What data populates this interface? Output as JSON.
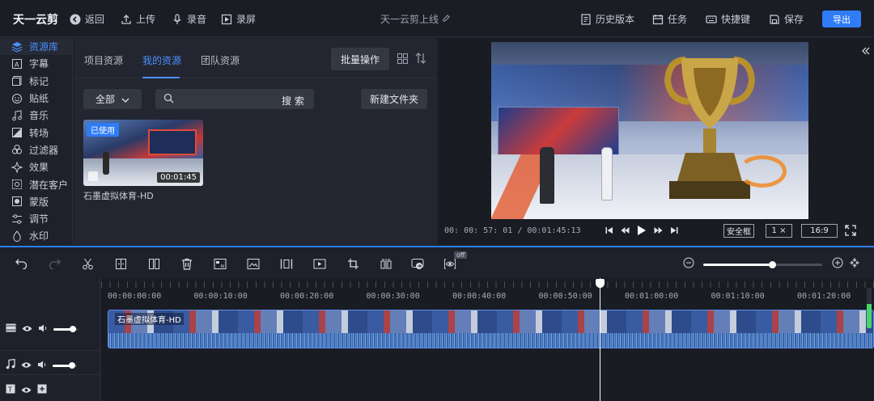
{
  "topbar": {
    "app_title": "天一云剪",
    "back": "返回",
    "upload": "上传",
    "record_audio": "录音",
    "record_screen": "录屏",
    "project_name": "天一云剪上线",
    "history": "历史版本",
    "tasks": "任务",
    "shortcuts": "快捷键",
    "save": "保存",
    "export": "导出"
  },
  "sidebar": {
    "items": [
      {
        "label": "资源库",
        "icon": "layers-icon"
      },
      {
        "label": "字幕",
        "icon": "text-icon"
      },
      {
        "label": "标记",
        "icon": "mark-icon"
      },
      {
        "label": "贴纸",
        "icon": "sticker-icon"
      },
      {
        "label": "音乐",
        "icon": "music-icon"
      },
      {
        "label": "转场",
        "icon": "transition-icon"
      },
      {
        "label": "过滤器",
        "icon": "filter-icon"
      },
      {
        "label": "效果",
        "icon": "effect-icon"
      },
      {
        "label": "潜在客户",
        "icon": "leads-icon"
      },
      {
        "label": "蒙版",
        "icon": "mask-icon"
      },
      {
        "label": "调节",
        "icon": "adjust-icon"
      },
      {
        "label": "水印",
        "icon": "watermark-icon"
      }
    ]
  },
  "resource": {
    "tabs": [
      "项目资源",
      "我的资源",
      "团队资源"
    ],
    "active_tab": 1,
    "batch": "批量操作",
    "filter": "全部",
    "search_placeholder": "",
    "search_button": "搜 索",
    "new_folder": "新建文件夹",
    "items": [
      {
        "name": "石墨虚拟体育-HD",
        "badge": "已使用",
        "duration": "00:01:45"
      }
    ]
  },
  "preview": {
    "current_time": "00: 00: 57: 01",
    "total_time": "/ 00:01:45:13",
    "safe_frame": "安全框",
    "speed": "1 ×",
    "ratio": "16:9"
  },
  "timeline": {
    "off_tag": "off",
    "zoom": 0.58,
    "ticks": [
      "00:00:00:00",
      "00:00:10:00",
      "00:00:20:00",
      "00:00:30:00",
      "00:00:40:00",
      "00:00:50:00",
      "00:01:00:00",
      "00:01:10:00",
      "00:01:20:00"
    ],
    "clip_name": "石墨虚拟体育-HD",
    "video_volume": 0.8,
    "audio_volume": 0.8
  }
}
